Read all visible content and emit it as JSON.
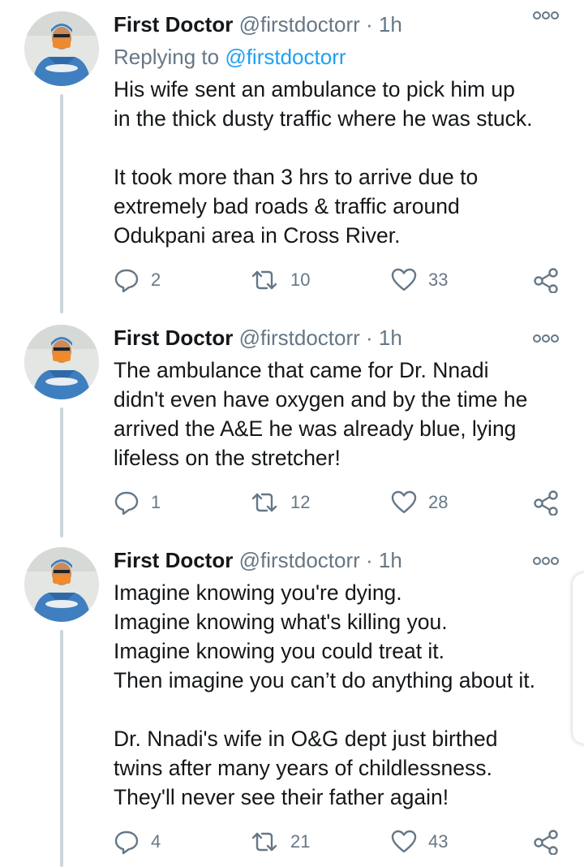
{
  "tweets": [
    {
      "name": "First Doctor",
      "handle": "@firstdoctorr",
      "separator": "·",
      "time": "1h",
      "replying_prefix": "Replying to",
      "replying_to": "@firstdoctorr",
      "text": "His wife sent an ambulance to pick him up\nin the thick dusty traffic where he was stuck.\n\nIt took more than 3 hrs to arrive due to\nextremely bad roads & traffic around\nOdukpani area in Cross River.",
      "replies": "2",
      "retweets": "10",
      "likes": "33"
    },
    {
      "name": "First Doctor",
      "handle": "@firstdoctorr",
      "separator": "·",
      "time": "1h",
      "text": "The ambulance that came for Dr. Nnadi\ndidn't even have oxygen and by the time he\narrived the A&E he was already blue, lying\nlifeless on the stretcher!",
      "replies": "1",
      "retweets": "12",
      "likes": "28"
    },
    {
      "name": "First Doctor",
      "handle": "@firstdoctorr",
      "separator": "·",
      "time": "1h",
      "text": "Imagine knowing you're dying.\nImagine knowing what's killing you.\nImagine knowing you could treat it.\nThen imagine you can’t do anything about it.\n\nDr. Nnadi's wife in O&G dept just birthed\ntwins after many years of childlessness.\nThey'll never see their father again!",
      "replies": "4",
      "retweets": "21",
      "likes": "43"
    }
  ],
  "icons": {
    "reply": "reply-icon",
    "retweet": "retweet-icon",
    "like": "heart-icon",
    "share": "share-icon",
    "more": "more-options-icon"
  },
  "colors": {
    "name": "#14171a",
    "secondary": "#657786",
    "link": "#1da1f2",
    "thread_line": "#ccd6dd"
  }
}
